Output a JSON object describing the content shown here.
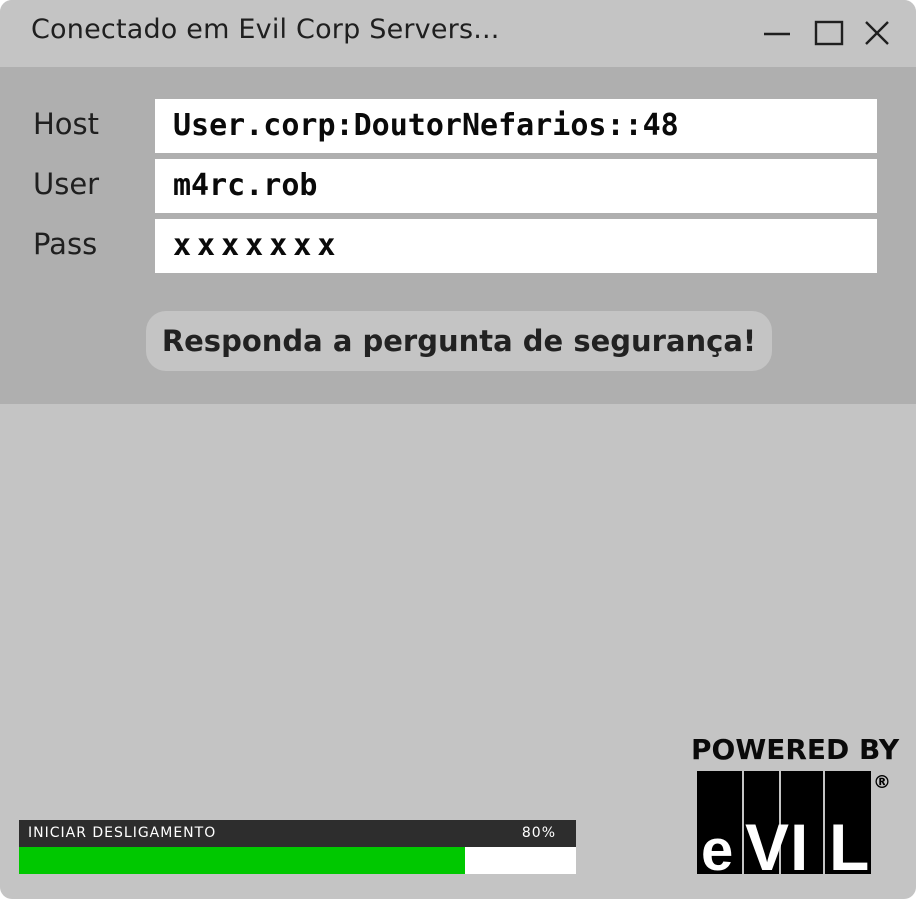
{
  "window": {
    "title": "Conectado em Evil Corp Servers...",
    "controls": {
      "minimize_icon": "minimize-icon",
      "maximize_icon": "maximize-icon",
      "close_icon": "close-icon"
    }
  },
  "login": {
    "host_label": "Host",
    "host_value": "User.corp:DoutorNefarios::48",
    "user_label": "User",
    "user_value": "m4rc.rob",
    "pass_label": "Pass",
    "pass_value": "xxxxxxx",
    "security_button_label": "Responda a pergunta de segurança!"
  },
  "shutdown": {
    "label": "INICIAR DESLIGAMENTO",
    "percent_text": "80%",
    "progress": 0.8,
    "fill_color": "#00c800"
  },
  "branding": {
    "powered_by": "POWERED BY",
    "logo_text": "eVIL",
    "registered_mark": "®"
  },
  "colors": {
    "window_bg": "#c4c4c4",
    "panel_bg": "#afafaf",
    "progress_header_bg": "#2d2d2d"
  }
}
